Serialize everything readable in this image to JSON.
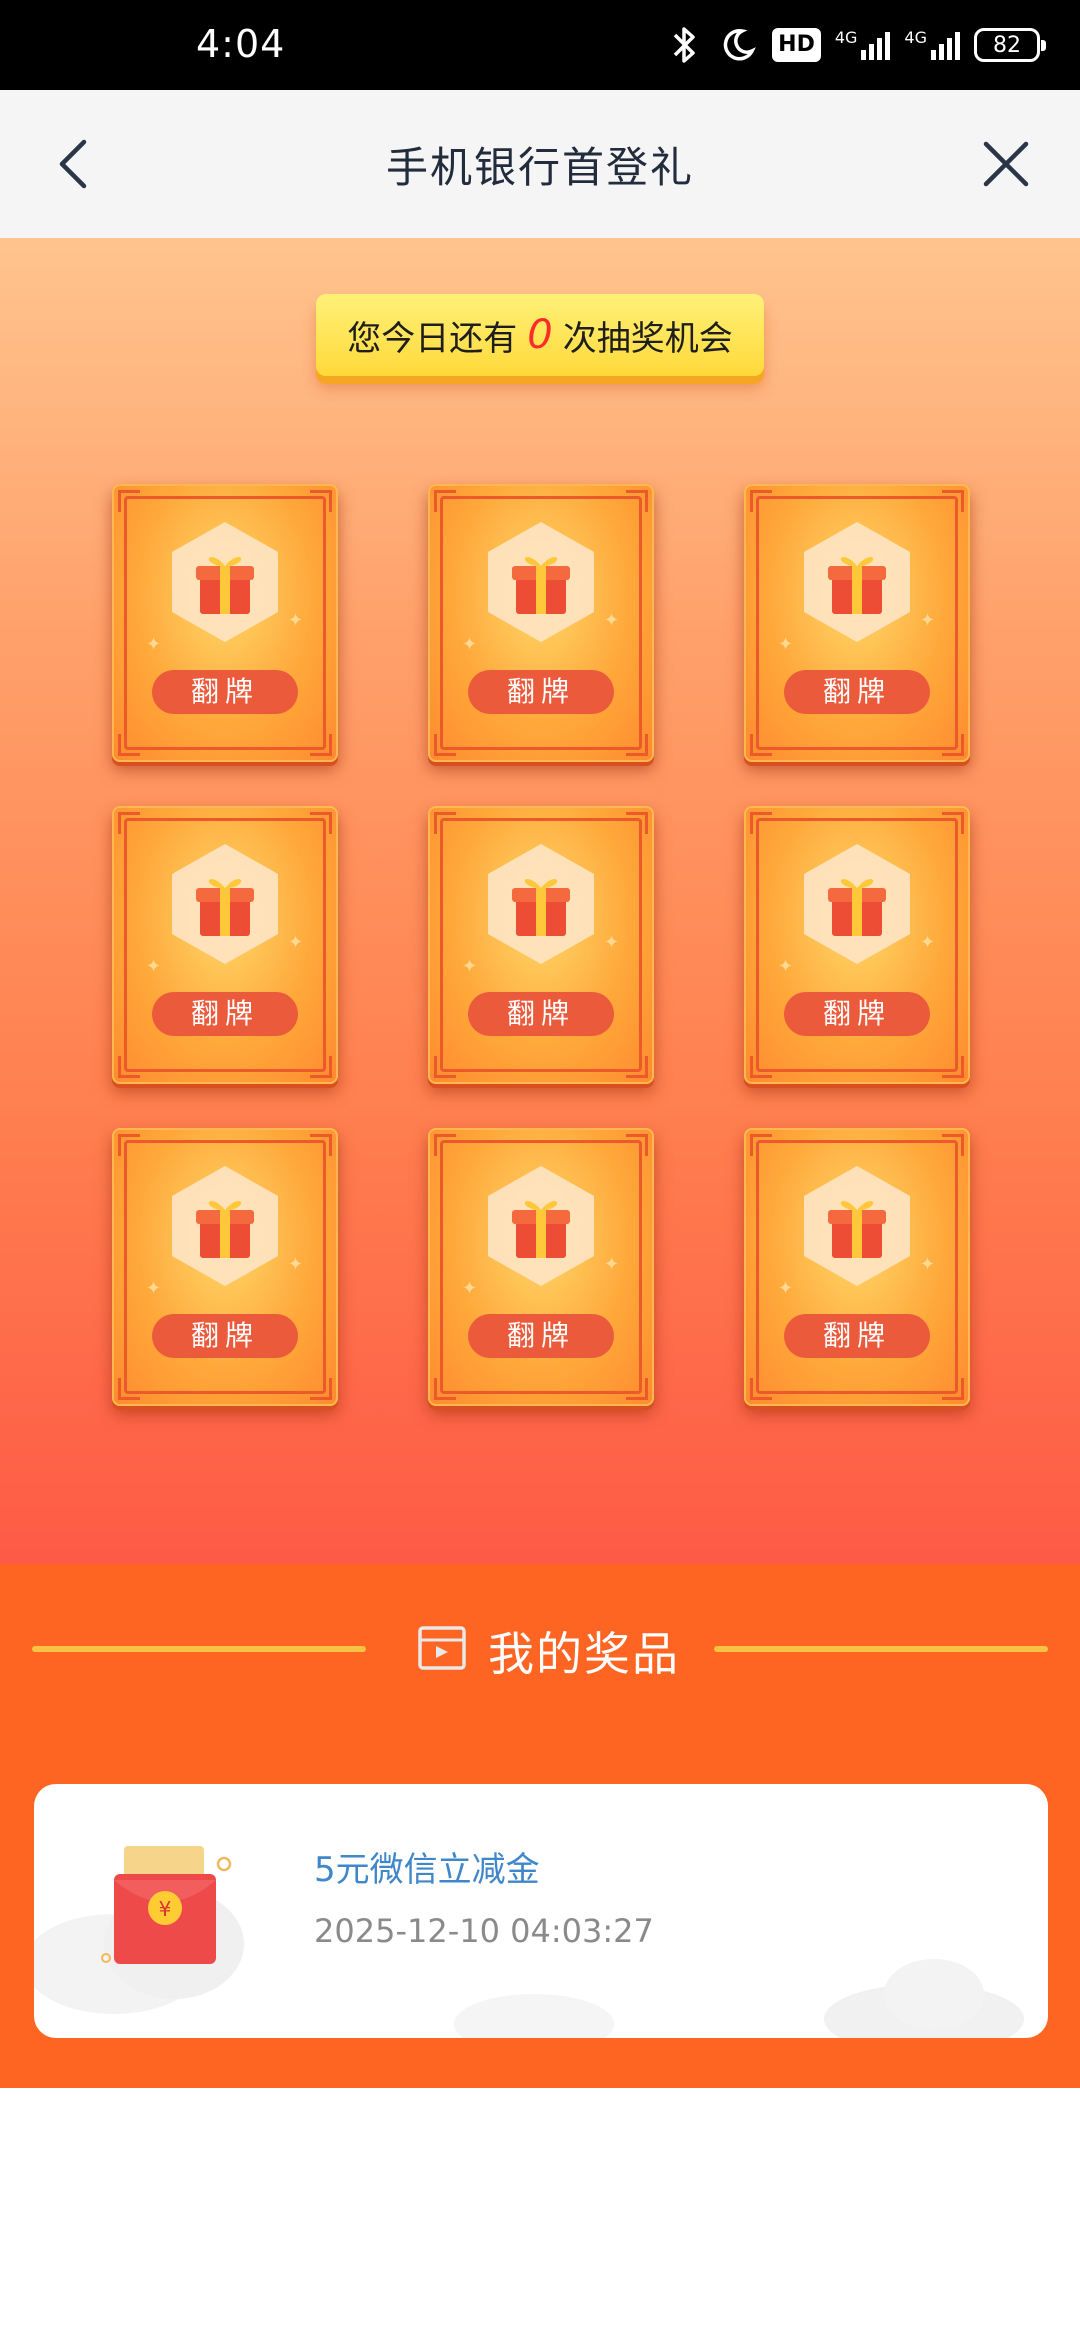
{
  "status_bar": {
    "time": "4:04",
    "hd_label": "HD",
    "network_1": "4G",
    "network_2": "4G",
    "battery": "82",
    "icons": [
      "bluetooth-icon",
      "moon-icon",
      "hd-icon",
      "signal-icon",
      "signal-icon",
      "battery-icon"
    ]
  },
  "nav": {
    "title": "手机银行首登礼",
    "back_icon": "chevron-left-icon",
    "close_icon": "close-icon"
  },
  "game": {
    "chance_prefix": "您今日还有",
    "chance_count": "0",
    "chance_suffix": "次抽奖机会",
    "cards": [
      {
        "label": "翻牌",
        "icon": "gift-icon"
      },
      {
        "label": "翻牌",
        "icon": "gift-icon"
      },
      {
        "label": "翻牌",
        "icon": "gift-icon"
      },
      {
        "label": "翻牌",
        "icon": "gift-icon"
      },
      {
        "label": "翻牌",
        "icon": "gift-icon"
      },
      {
        "label": "翻牌",
        "icon": "gift-icon"
      },
      {
        "label": "翻牌",
        "icon": "gift-icon"
      },
      {
        "label": "翻牌",
        "icon": "gift-icon"
      },
      {
        "label": "翻牌",
        "icon": "gift-icon"
      }
    ]
  },
  "prizes": {
    "heading": "我的奖品",
    "items": [
      {
        "name": "5元微信立减金",
        "time": "2025-12-10 04:03:27",
        "icon": "red-envelope-icon"
      }
    ]
  },
  "colors": {
    "accent_orange": "#ff6522",
    "chance_red": "#ff2b2b",
    "prize_blue": "#3f87c9",
    "banner_yellow": "#ffd93a"
  }
}
